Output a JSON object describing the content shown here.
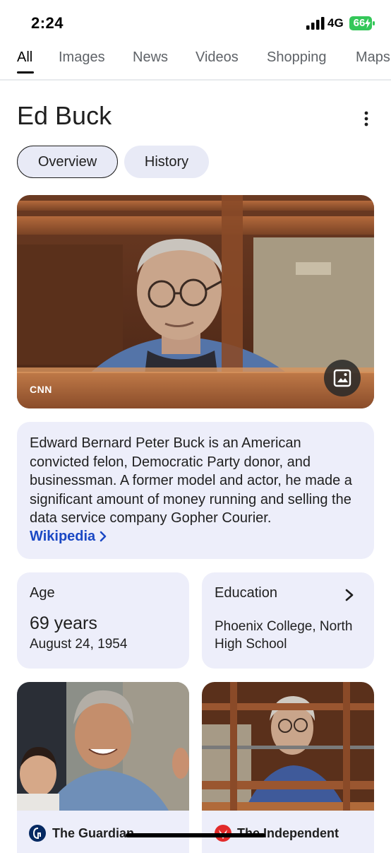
{
  "status_bar": {
    "time": "2:24",
    "network": "4G",
    "battery": "66"
  },
  "tabs": [
    {
      "label": "All",
      "active": true
    },
    {
      "label": "Images"
    },
    {
      "label": "News"
    },
    {
      "label": "Videos"
    },
    {
      "label": "Shopping"
    },
    {
      "label": "Maps"
    }
  ],
  "entity": {
    "title": "Ed Buck"
  },
  "chips": {
    "overview": "Overview",
    "history": "History"
  },
  "hero": {
    "source": "CNN"
  },
  "description": {
    "text": "Edward Bernard Peter Buck is an American convicted felon, Democratic Party donor, and businessman. A former model and actor, he made a significant amount of money running and selling the data service company Gopher Courier.",
    "link": "Wikipedia"
  },
  "facts": {
    "age": {
      "label": "Age",
      "value": "69 years",
      "date": "August 24, 1954"
    },
    "education": {
      "label": "Education",
      "value": "Phoenix College, North High School"
    }
  },
  "news": [
    {
      "source": "The Guardian",
      "icon": "guardian-icon"
    },
    {
      "source": "The Independent",
      "icon": "independent-icon"
    }
  ],
  "colors": {
    "chip_bg": "#e8eaf6",
    "card_bg": "#edeefa",
    "link": "#1a48c4",
    "battery": "#34c759"
  }
}
